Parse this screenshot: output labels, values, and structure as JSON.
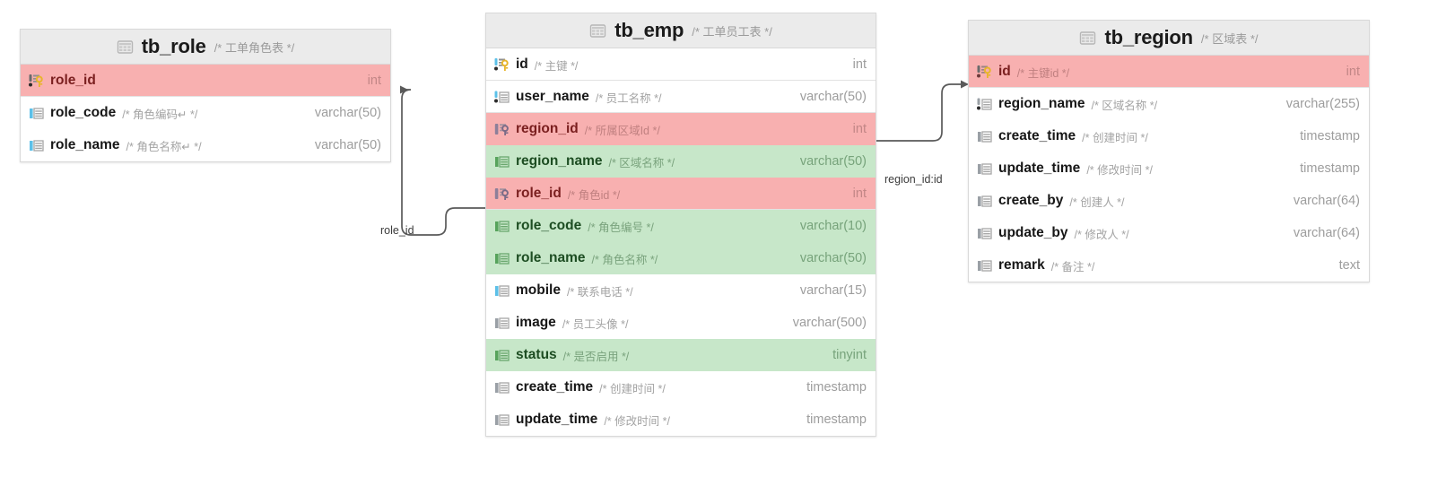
{
  "diagram": {
    "type": "database-er-diagram",
    "background": "#ffffff",
    "colors": {
      "header_bg": "#ebebeb",
      "primary_key_row": "#f8b0b0",
      "highlight_row": "#c7e7c9",
      "border": "#d9d9d9",
      "connector": "#5a5a5a",
      "key_icon": "#e8b52b"
    }
  },
  "tables": [
    {
      "name": "tb_role",
      "comment": "/* 工单角色表 */",
      "icon": "table-icon",
      "columns": [
        {
          "name": "role_id",
          "comment": "",
          "type": "int",
          "style": "pk",
          "icon": "primary-key-icon",
          "bar": "gray"
        },
        {
          "name": "role_code",
          "comment": "/* 角色编码↵ */",
          "type": "varchar(50)",
          "style": "normal",
          "icon": "column-icon",
          "bar": "blue"
        },
        {
          "name": "role_name",
          "comment": "/* 角色名称↵ */",
          "type": "varchar(50)",
          "style": "normal",
          "icon": "column-icon",
          "bar": "blue"
        }
      ]
    },
    {
      "name": "tb_emp",
      "comment": "/* 工单员工表 */",
      "icon": "table-icon",
      "columns": [
        {
          "name": "id",
          "comment": "/* 主键 */",
          "type": "int",
          "style": "pk-white",
          "icon": "primary-key-icon",
          "bar": "blue"
        },
        {
          "name": "user_name",
          "comment": "/* 员工名称 */",
          "type": "varchar(50)",
          "style": "normal",
          "icon": "column-icon",
          "bar": "blue"
        },
        {
          "name": "region_id",
          "comment": "/* 所属区域Id */",
          "type": "int",
          "style": "pk",
          "icon": "foreign-key-icon",
          "bar": "purple"
        },
        {
          "name": "region_name",
          "comment": "/* 区域名称 */",
          "type": "varchar(50)",
          "style": "green",
          "icon": "column-icon",
          "bar": "green"
        },
        {
          "name": "role_id",
          "comment": "/* 角色id */",
          "type": "int",
          "style": "pk",
          "icon": "foreign-key-icon",
          "bar": "purple"
        },
        {
          "name": "role_code",
          "comment": "/* 角色编号 */",
          "type": "varchar(10)",
          "style": "green",
          "icon": "column-icon",
          "bar": "green"
        },
        {
          "name": "role_name",
          "comment": "/* 角色名称 */",
          "type": "varchar(50)",
          "style": "green",
          "icon": "column-icon",
          "bar": "green"
        },
        {
          "name": "mobile",
          "comment": "/* 联系电话 */",
          "type": "varchar(15)",
          "style": "normal",
          "icon": "column-icon",
          "bar": "blue"
        },
        {
          "name": "image",
          "comment": "/* 员工头像 */",
          "type": "varchar(500)",
          "style": "normal",
          "icon": "column-icon",
          "bar": "gray"
        },
        {
          "name": "status",
          "comment": "/* 是否启用 */",
          "type": "tinyint",
          "style": "green",
          "icon": "column-icon",
          "bar": "green"
        },
        {
          "name": "create_time",
          "comment": "/* 创建时间 */",
          "type": "timestamp",
          "style": "normal",
          "icon": "column-icon",
          "bar": "gray"
        },
        {
          "name": "update_time",
          "comment": "/* 修改时间 */",
          "type": "timestamp",
          "style": "normal",
          "icon": "column-icon",
          "bar": "gray"
        }
      ]
    },
    {
      "name": "tb_region",
      "comment": "/* 区域表 */",
      "icon": "table-icon",
      "columns": [
        {
          "name": "id",
          "comment": "/* 主键id */",
          "type": "int",
          "style": "pk",
          "icon": "primary-key-icon",
          "bar": "gray"
        },
        {
          "name": "region_name",
          "comment": "/* 区域名称 */",
          "type": "varchar(255)",
          "style": "normal",
          "icon": "column-icon",
          "bar": "gray"
        },
        {
          "name": "create_time",
          "comment": "/* 创建时间 */",
          "type": "timestamp",
          "style": "normal",
          "icon": "column-icon",
          "bar": "gray"
        },
        {
          "name": "update_time",
          "comment": "/* 修改时间 */",
          "type": "timestamp",
          "style": "normal",
          "icon": "column-icon",
          "bar": "gray"
        },
        {
          "name": "create_by",
          "comment": "/* 创建人 */",
          "type": "varchar(64)",
          "style": "normal",
          "icon": "column-icon",
          "bar": "gray"
        },
        {
          "name": "update_by",
          "comment": "/* 修改人 */",
          "type": "varchar(64)",
          "style": "normal",
          "icon": "column-icon",
          "bar": "gray"
        },
        {
          "name": "remark",
          "comment": "/* 备注 */",
          "type": "text",
          "style": "normal",
          "icon": "column-icon",
          "bar": "gray"
        }
      ]
    }
  ],
  "relationships": [
    {
      "label": "role_id",
      "from": "tb_emp.role_id",
      "to": "tb_role.role_id"
    },
    {
      "label": "region_id:id",
      "from": "tb_emp.region_id",
      "to": "tb_region.id"
    }
  ]
}
